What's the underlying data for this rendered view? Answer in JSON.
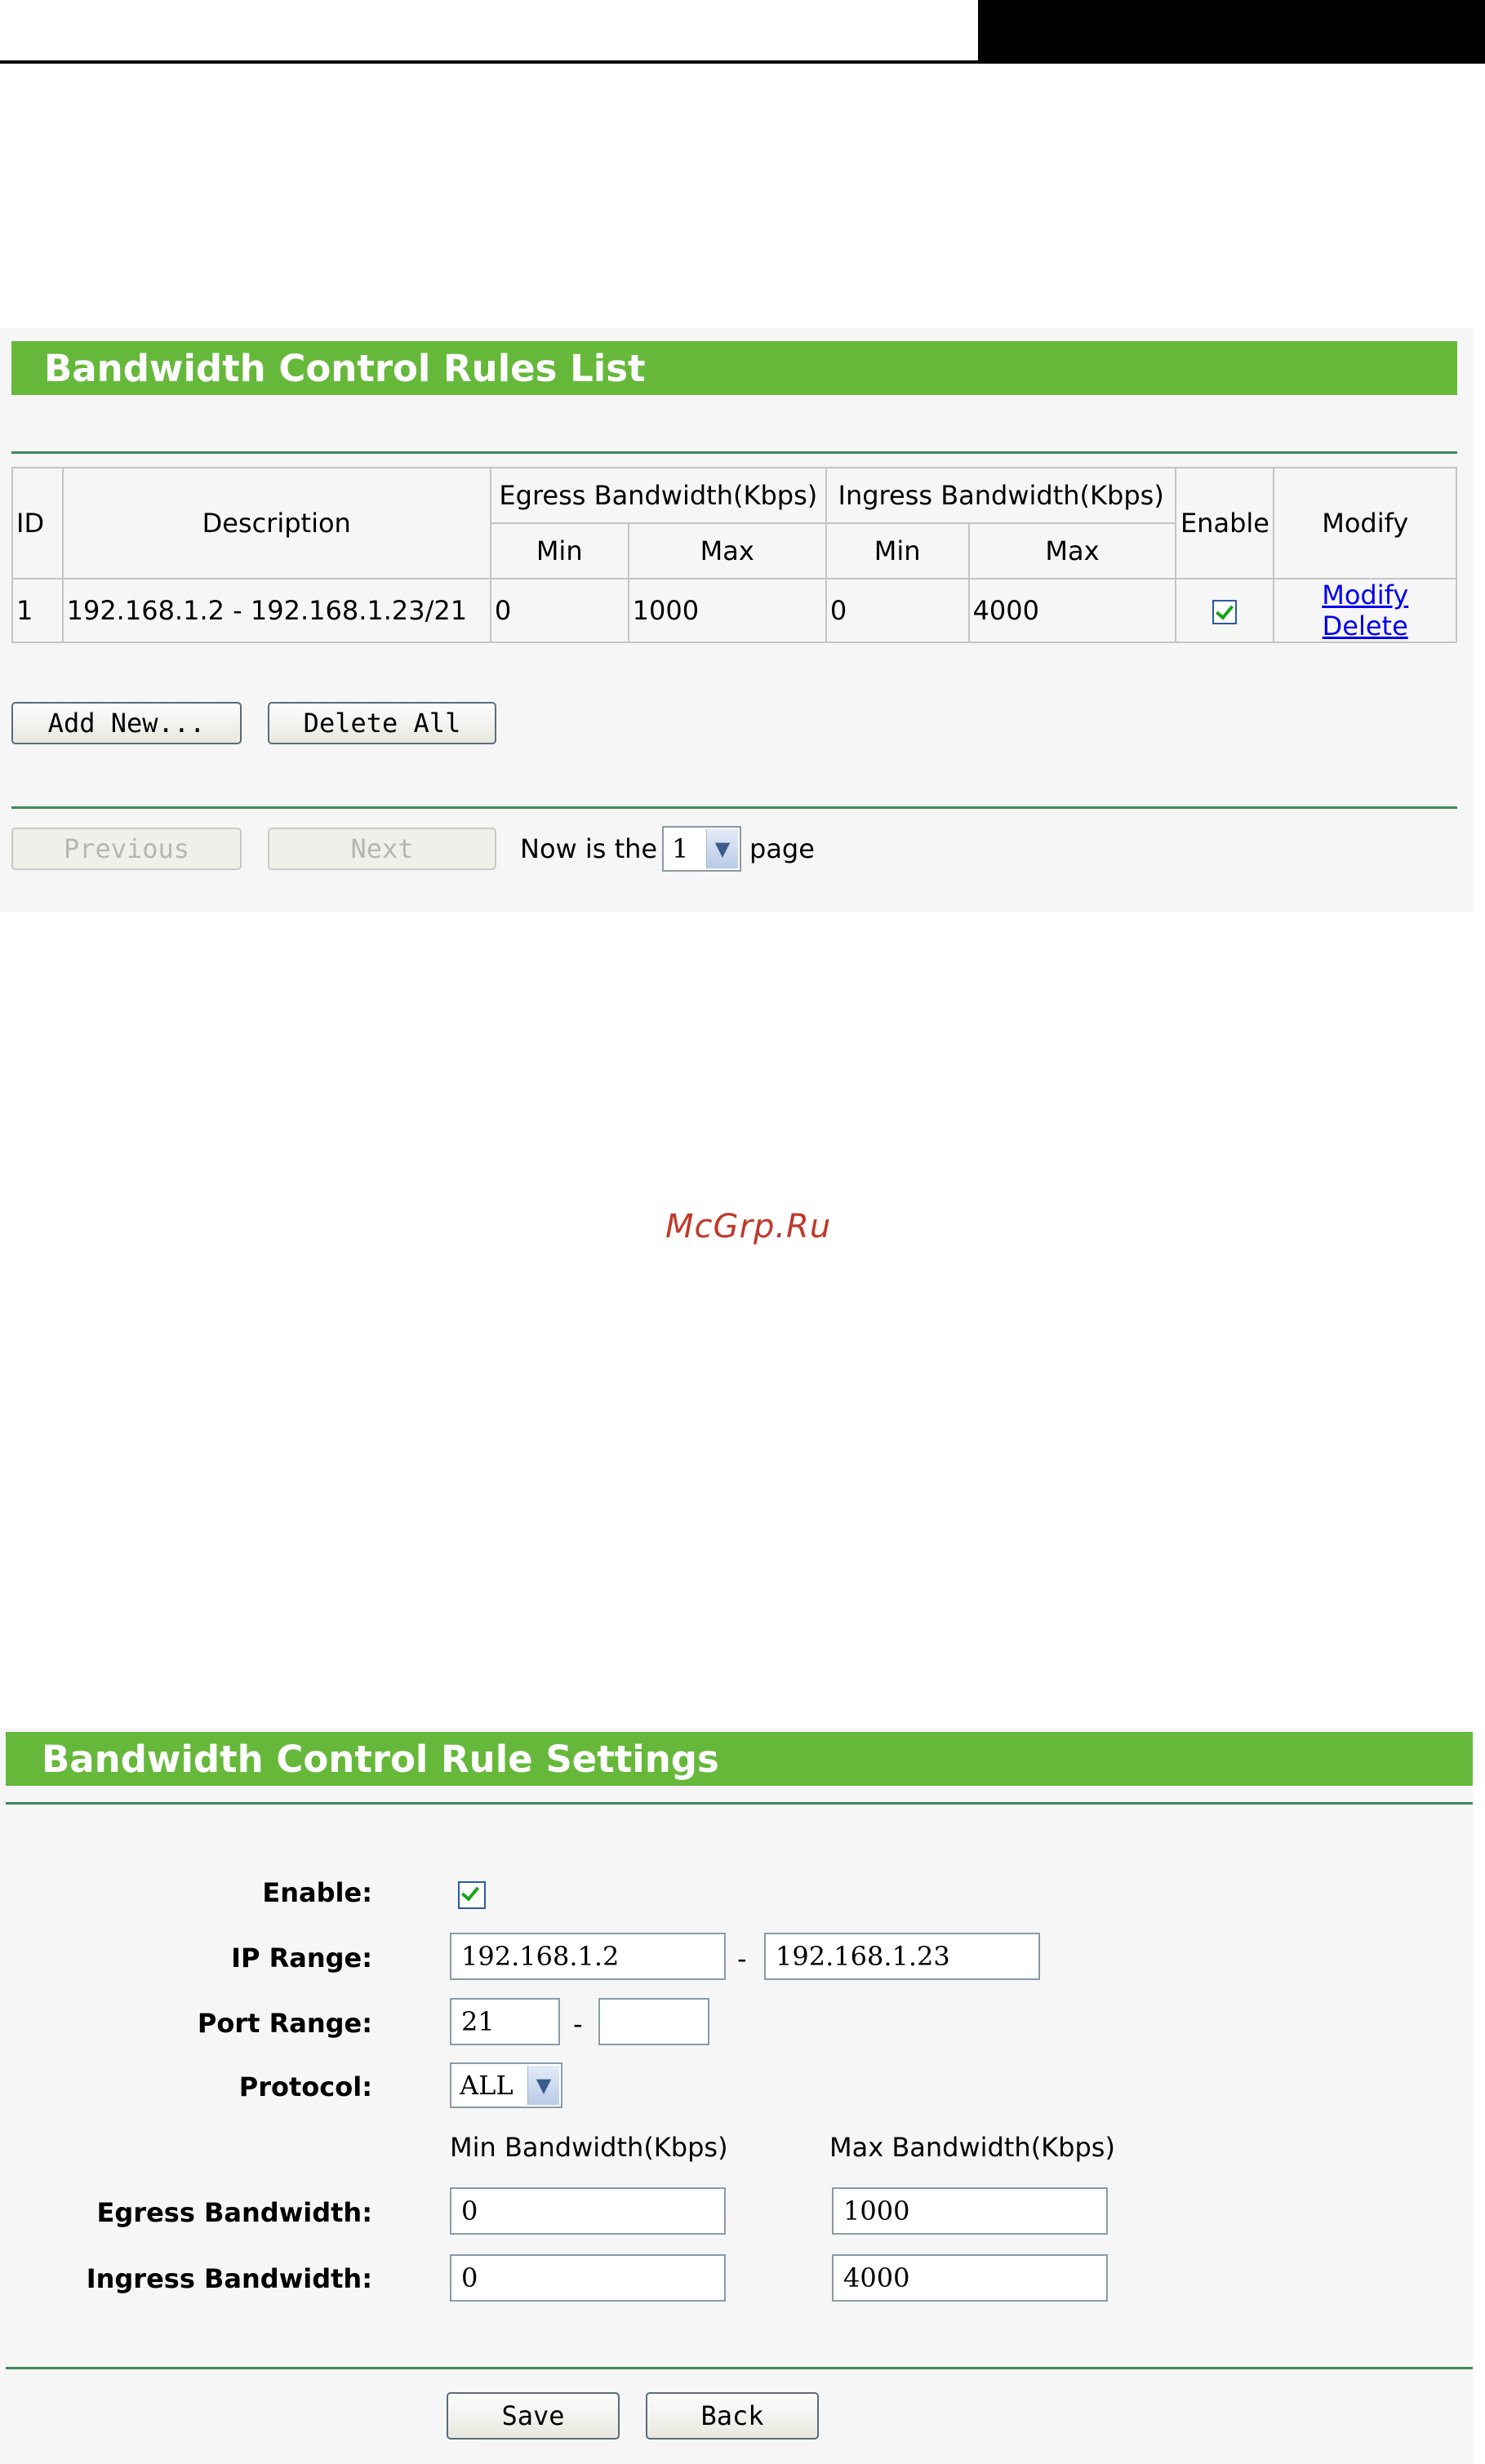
{
  "rules_list": {
    "title": "Bandwidth Control Rules List",
    "columns": {
      "id": "ID",
      "description": "Description",
      "egress": "Egress Bandwidth(Kbps)",
      "ingress": "Ingress Bandwidth(Kbps)",
      "min": "Min",
      "max": "Max",
      "enable": "Enable",
      "modify": "Modify"
    },
    "rows": [
      {
        "id": "1",
        "description": "192.168.1.2 - 192.168.1.23/21",
        "egress_min": "0",
        "egress_max": "1000",
        "ingress_min": "0",
        "ingress_max": "4000",
        "enabled": true,
        "modify_link": "Modify",
        "delete_link": "Delete"
      }
    ],
    "add_new_label": "Add New...",
    "delete_all_label": "Delete All",
    "previous_label": "Previous",
    "next_label": "Next",
    "page_prefix": "Now is the",
    "page_value": "1",
    "page_suffix": "page"
  },
  "watermark": "McGrp.Ru",
  "rule_settings": {
    "title": "Bandwidth Control Rule Settings",
    "enable_label": "Enable:",
    "enabled": true,
    "ip_range_label": "IP Range:",
    "ip_start": "192.168.1.2",
    "ip_end": "192.168.1.23",
    "range_separator": "-",
    "port_range_label": "Port Range:",
    "port_start": "21",
    "port_end": "",
    "protocol_label": "Protocol:",
    "protocol_value": "ALL",
    "min_bw_header": "Min Bandwidth(Kbps)",
    "max_bw_header": "Max Bandwidth(Kbps)",
    "egress_label": "Egress Bandwidth:",
    "egress_min": "0",
    "egress_max": "1000",
    "ingress_label": "Ingress Bandwidth:",
    "ingress_min": "0",
    "ingress_max": "4000",
    "save_label": "Save",
    "back_label": "Back"
  },
  "colors": {
    "header_green": "#66b83a",
    "separator": "#3d8b5c",
    "link": "#0000ee",
    "checkmark": "#18a318"
  }
}
